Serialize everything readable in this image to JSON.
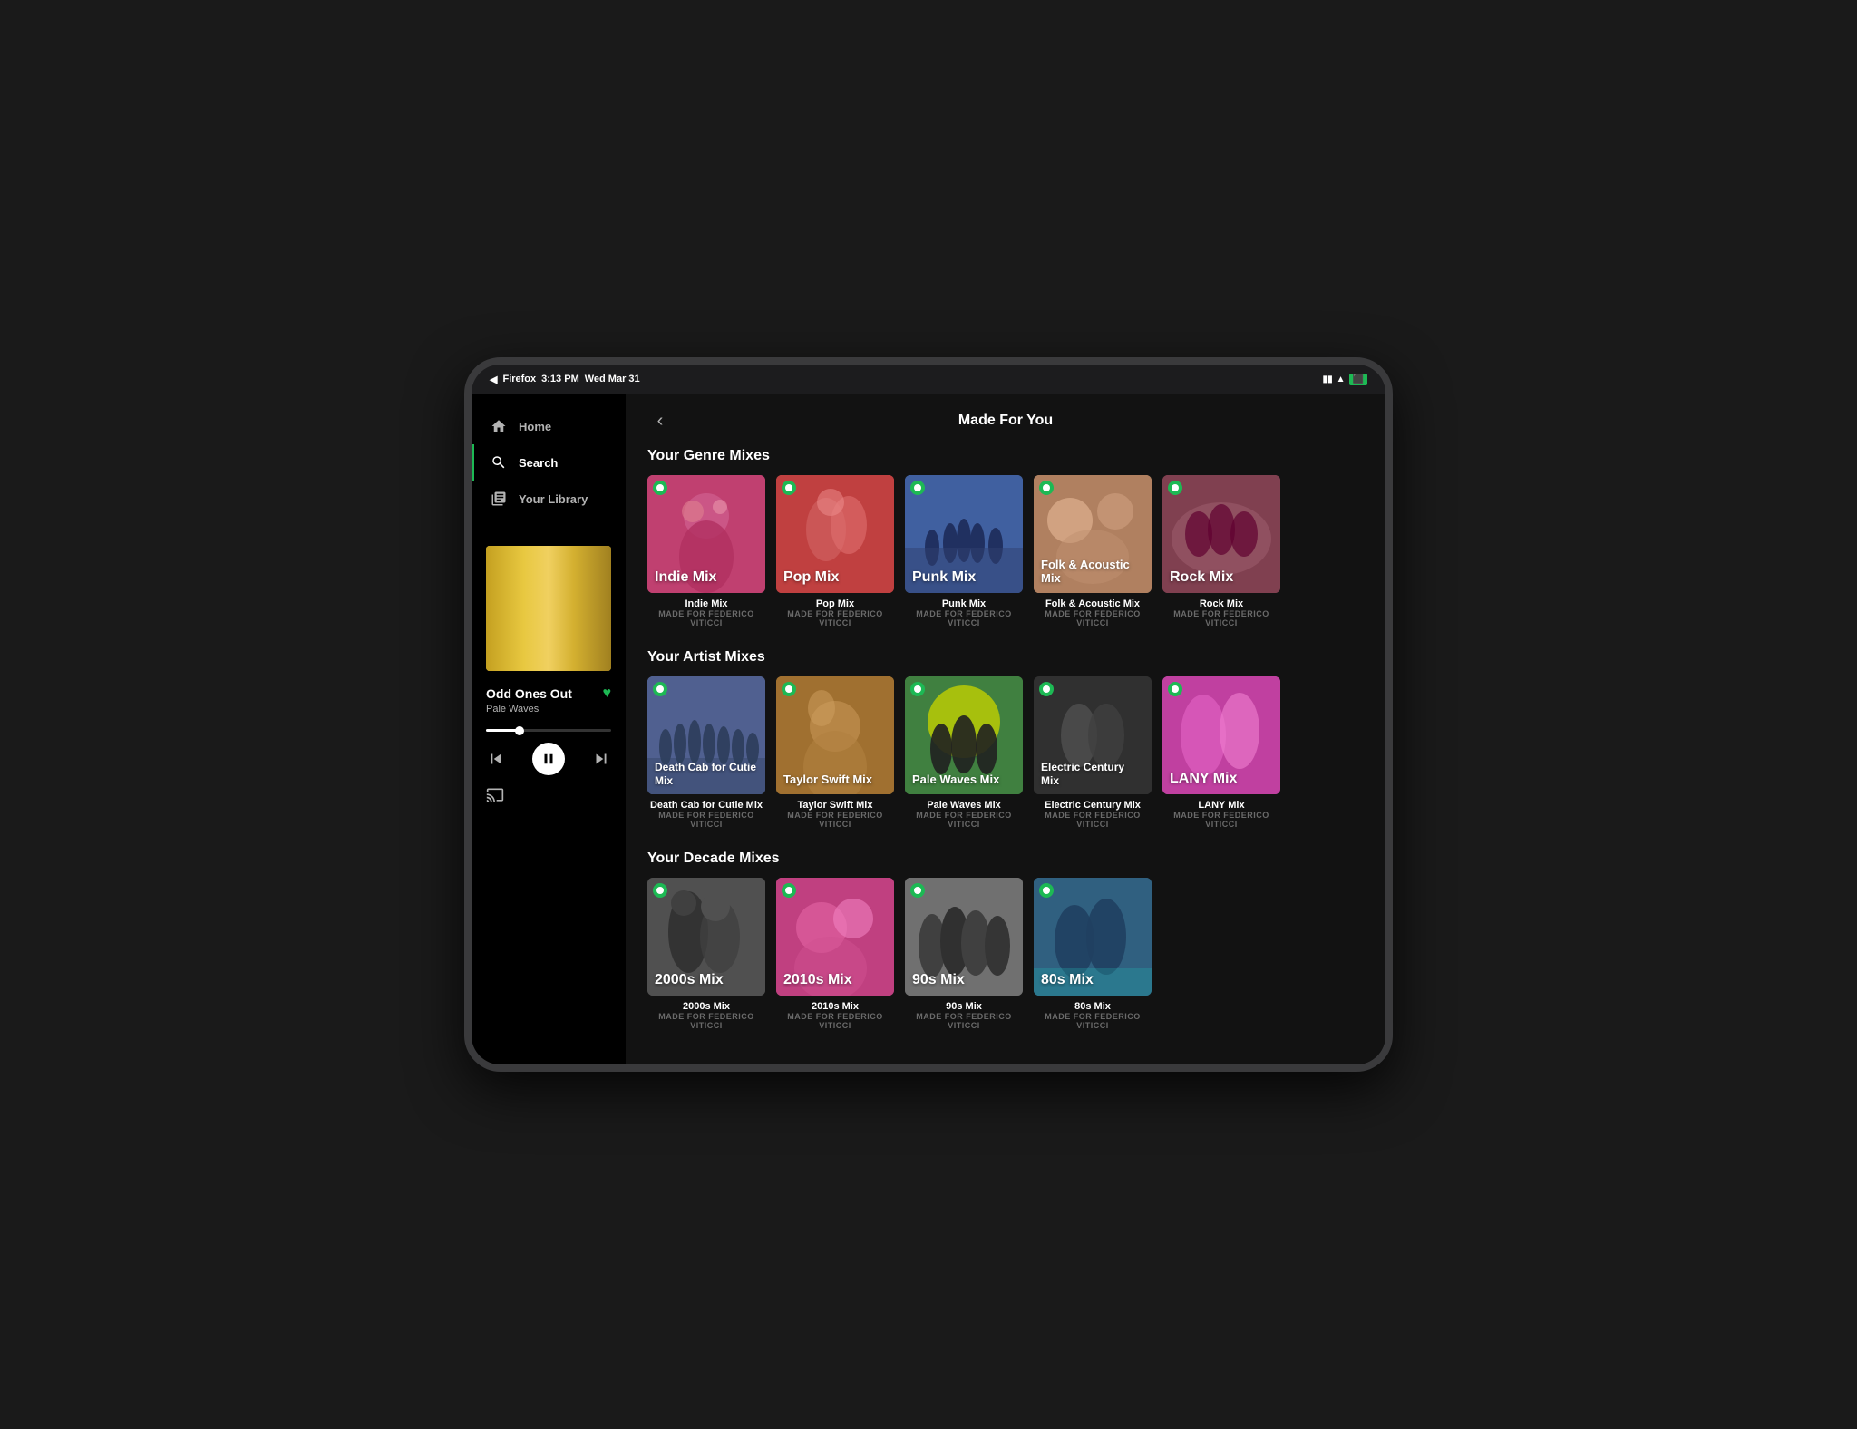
{
  "device": {
    "status_bar": {
      "browser": "Firefox",
      "time": "3:13 PM",
      "date": "Wed Mar 31"
    }
  },
  "sidebar": {
    "nav_items": [
      {
        "id": "home",
        "label": "Home",
        "icon": "home-icon",
        "active": false
      },
      {
        "id": "search",
        "label": "Search",
        "icon": "search-icon",
        "active": true
      },
      {
        "id": "library",
        "label": "Your Library",
        "icon": "library-icon",
        "active": false
      }
    ],
    "now_playing": {
      "title": "Odd Ones Out",
      "artist": "Pale Waves",
      "heart": true
    },
    "controls": {
      "prev": "⏮",
      "play": "⏸",
      "next": "⏭"
    }
  },
  "main": {
    "page_title": "Made For You",
    "back_label": "‹",
    "sections": [
      {
        "id": "genre-mixes",
        "title": "Your Genre Mixes",
        "cards": [
          {
            "name": "Indie Mix",
            "subtitle": "MADE FOR FEDERICO VITICCI",
            "label": "Indie Mix",
            "art_class": "indie-mix"
          },
          {
            "name": "Pop Mix",
            "subtitle": "MADE FOR FEDERICO VITICCI",
            "label": "Pop Mix",
            "art_class": "pop-mix"
          },
          {
            "name": "Punk Mix",
            "subtitle": "MADE FOR FEDERICO VITICCI",
            "label": "Punk Mix",
            "art_class": "punk-mix"
          },
          {
            "name": "Folk & Acoustic Mix",
            "subtitle": "MADE FOR FEDERICO VITICCI",
            "label": "Folk & Acoustic Mix",
            "art_class": "folk-mix"
          },
          {
            "name": "Rock Mix",
            "subtitle": "MADE FOR FEDERICO VITICCI",
            "label": "Rock Mix",
            "art_class": "rock-mix"
          }
        ]
      },
      {
        "id": "artist-mixes",
        "title": "Your Artist Mixes",
        "cards": [
          {
            "name": "Death Cab for Cutie Mix",
            "subtitle": "MADE FOR FEDERICO VITICCI",
            "label": "Death Cab for Cutie Mix",
            "art_class": "dcfc-mix"
          },
          {
            "name": "Taylor Swift Mix",
            "subtitle": "MADE FOR FEDERICO VITICCI",
            "label": "Taylor Swift Mix",
            "art_class": "taylor-mix"
          },
          {
            "name": "Pale Waves Mix",
            "subtitle": "MADE FOR FEDERICO VITICCI",
            "label": "Pale Waves Mix",
            "art_class": "pale-waves-mix"
          },
          {
            "name": "Electric Century Mix",
            "subtitle": "MADE FOR FEDERICO VITICCI",
            "label": "Electric Century Mix",
            "art_class": "electric-mix"
          },
          {
            "name": "LANY Mix",
            "subtitle": "MADE FOR FEDERICO VITICCI",
            "label": "LANY Mix",
            "art_class": "lany-mix"
          }
        ]
      },
      {
        "id": "decade-mixes",
        "title": "Your Decade Mixes",
        "cards": [
          {
            "name": "2000s Mix",
            "subtitle": "MADE FOR FEDERICO VITICCI",
            "label": "2000s Mix",
            "art_class": "y2000-mix"
          },
          {
            "name": "2010s Mix",
            "subtitle": "MADE FOR FEDERICO VITICCI",
            "label": "2010s Mix",
            "art_class": "y2010-mix"
          },
          {
            "name": "90s Mix",
            "subtitle": "MADE FOR FEDERICO VITICCI",
            "label": "90s Mix",
            "art_class": "y90s-mix"
          },
          {
            "name": "80s Mix",
            "subtitle": "MADE FOR FEDERICO VITICCI",
            "label": "80s Mix",
            "art_class": "y80s-mix"
          }
        ]
      }
    ]
  }
}
